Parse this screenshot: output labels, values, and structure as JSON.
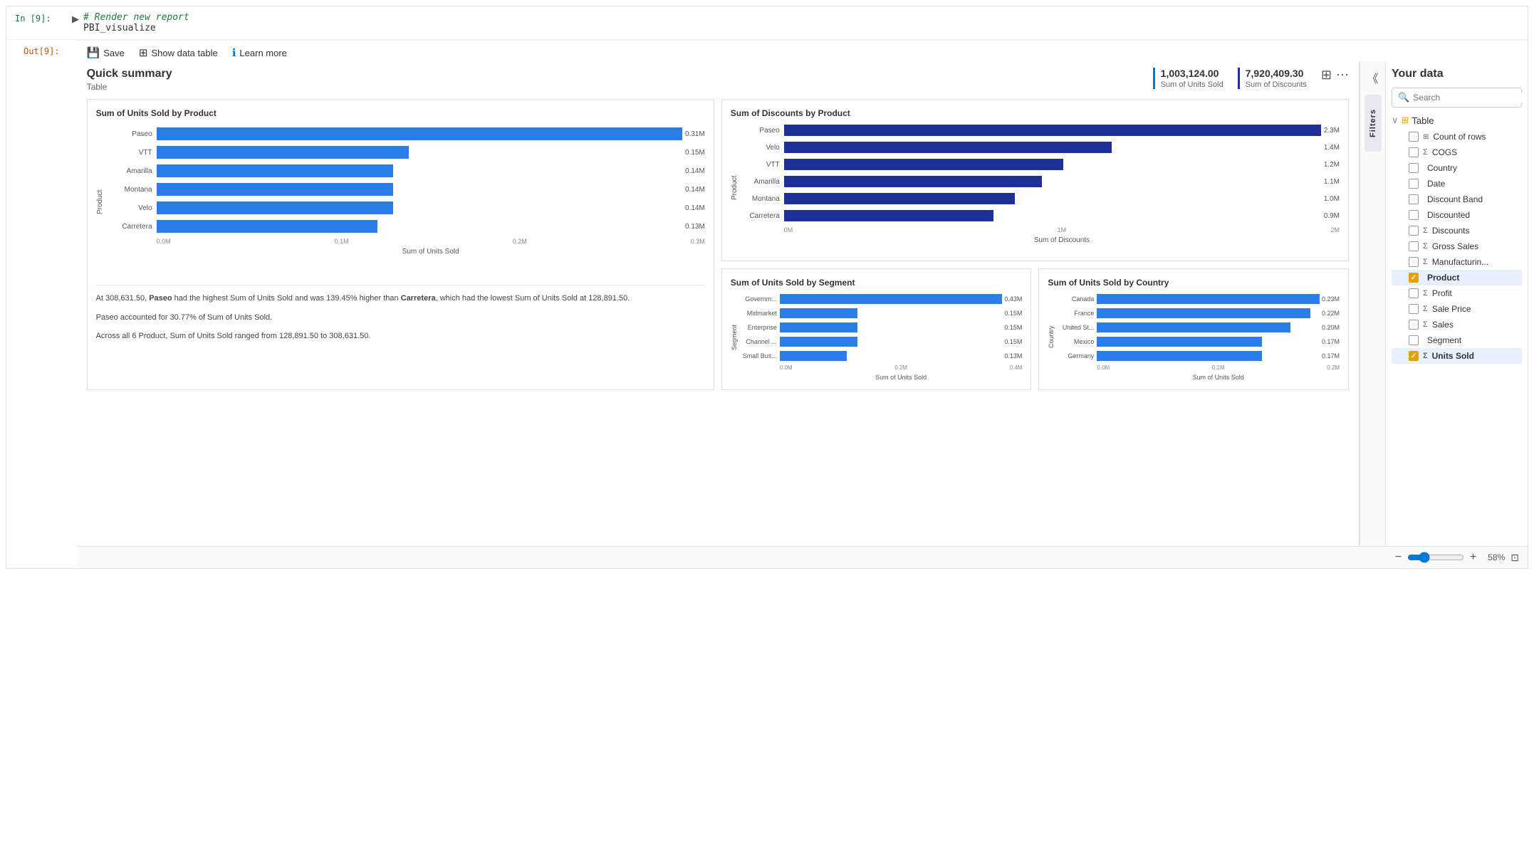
{
  "cell_input": {
    "label": "In [9]:",
    "code_comment": "# Render new report",
    "code_line": "PBI_visualize"
  },
  "cell_output": {
    "label": "Out[9]:"
  },
  "toolbar": {
    "save_label": "Save",
    "show_data_table_label": "Show data table",
    "learn_more_label": "Learn more"
  },
  "quick_summary": {
    "title": "Quick summary",
    "subtitle": "Table",
    "kpi1_value": "1,003,124.00",
    "kpi1_label": "Sum of Units Sold",
    "kpi2_value": "7,920,409.30",
    "kpi2_label": "Sum of Discounts"
  },
  "chart1": {
    "title": "Sum of Units Sold by Product",
    "bars": [
      {
        "label": "Paseo",
        "value": "0.31M",
        "pct": 100
      },
      {
        "label": "VTT",
        "value": "0.15M",
        "pct": 48
      },
      {
        "label": "Amarilla",
        "value": "0.14M",
        "pct": 45
      },
      {
        "label": "Montana",
        "value": "0.14M",
        "pct": 45
      },
      {
        "label": "Velo",
        "value": "0.14M",
        "pct": 45
      },
      {
        "label": "Carretera",
        "value": "0.13M",
        "pct": 42
      }
    ],
    "x_ticks": [
      "0.0M",
      "0.1M",
      "0.2M",
      "0.3M"
    ],
    "x_title": "Sum of Units Sold",
    "y_title": "Product"
  },
  "chart1_desc": [
    "At 308,631.50, Paseo had the highest Sum of Units Sold and was 139.45% higher than  Carretera, which had the lowest Sum of Units Sold at 128,891.50.",
    "Paseo accounted for 30.77% of Sum of Units Sold.",
    "Across all 6 Product, Sum of Units Sold ranged from 128,891.50 to 308,631.50."
  ],
  "chart2": {
    "title": "Sum of Discounts by Product",
    "bars": [
      {
        "label": "Paseo",
        "value": "2.3M",
        "pct": 100
      },
      {
        "label": "Velo",
        "value": "1.4M",
        "pct": 61
      },
      {
        "label": "VTT",
        "value": "1.2M",
        "pct": 52
      },
      {
        "label": "Amarilla",
        "value": "1.1M",
        "pct": 48
      },
      {
        "label": "Montana",
        "value": "1.0M",
        "pct": 43
      },
      {
        "label": "Carretera",
        "value": "0.9M",
        "pct": 39
      }
    ],
    "x_ticks": [
      "0M",
      "1M",
      "2M"
    ],
    "x_title": "Sum of Discounts",
    "y_title": "Product"
  },
  "chart3": {
    "title": "Sum of Units Sold by Segment",
    "bars": [
      {
        "label": "Governm...",
        "value": "0.43M",
        "pct": 100
      },
      {
        "label": "Midmarket",
        "value": "0.15M",
        "pct": 35
      },
      {
        "label": "Enterprise",
        "value": "0.15M",
        "pct": 35
      },
      {
        "label": "Channel ...",
        "value": "0.15M",
        "pct": 35
      },
      {
        "label": "Small Bus...",
        "value": "0.13M",
        "pct": 30
      }
    ],
    "x_ticks": [
      "0.0M",
      "0.2M",
      "0.4M"
    ],
    "x_title": "Sum of Units Sold",
    "y_title": "Segment"
  },
  "chart4": {
    "title": "Sum of Units Sold by Country",
    "bars": [
      {
        "label": "Canada",
        "value": "0.23M",
        "pct": 100
      },
      {
        "label": "France",
        "value": "0.22M",
        "pct": 96
      },
      {
        "label": "United St...",
        "value": "0.20M",
        "pct": 87
      },
      {
        "label": "Mexico",
        "value": "0.17M",
        "pct": 74
      },
      {
        "label": "Germany",
        "value": "0.17M",
        "pct": 74
      }
    ],
    "x_ticks": [
      "0.0M",
      "0.1M",
      "0.2M"
    ],
    "x_title": "Sum of Units Sold",
    "y_title": "Country"
  },
  "right_panel": {
    "title": "Your data",
    "search_placeholder": "Search",
    "filters_label": "Filters",
    "table_name": "Table",
    "fields": [
      {
        "name": "Count of rows",
        "type": "table",
        "checked": false
      },
      {
        "name": "COGS",
        "type": "sigma",
        "checked": false
      },
      {
        "name": "Country",
        "type": "field",
        "checked": false
      },
      {
        "name": "Date",
        "type": "field",
        "checked": false
      },
      {
        "name": "Discount Band",
        "type": "field",
        "checked": false
      },
      {
        "name": "Discounted",
        "type": "field",
        "checked": false
      },
      {
        "name": "Discounts",
        "type": "sigma",
        "checked": false
      },
      {
        "name": "Gross Sales",
        "type": "sigma",
        "checked": false
      },
      {
        "name": "Manufacturin...",
        "type": "sigma",
        "checked": false
      },
      {
        "name": "Product",
        "type": "field",
        "checked": true,
        "selected": true
      },
      {
        "name": "Profit",
        "type": "sigma",
        "checked": false
      },
      {
        "name": "Sale Price",
        "type": "sigma",
        "checked": false
      },
      {
        "name": "Sales",
        "type": "sigma",
        "checked": false
      },
      {
        "name": "Segment",
        "type": "field",
        "checked": false
      },
      {
        "name": "Units Sold",
        "type": "sigma",
        "checked": true
      }
    ]
  },
  "zoom": {
    "level": "58%",
    "minus": "-",
    "plus": "+"
  }
}
